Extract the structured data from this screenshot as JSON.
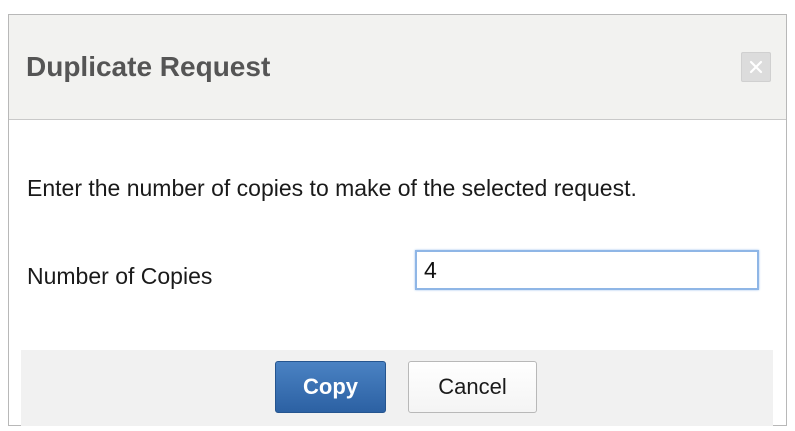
{
  "dialog": {
    "title": "Duplicate Request",
    "close_icon": "close-icon",
    "instruction": "Enter the number of copies to make of the selected request.",
    "copies_label": "Number of Copies",
    "copies_value": "4",
    "copy_button": "Copy",
    "cancel_button": "Cancel"
  },
  "colors": {
    "primary_button": "#3a70b3",
    "header_background": "#f2f2f0",
    "input_focus_border": "#8fb6e6"
  }
}
